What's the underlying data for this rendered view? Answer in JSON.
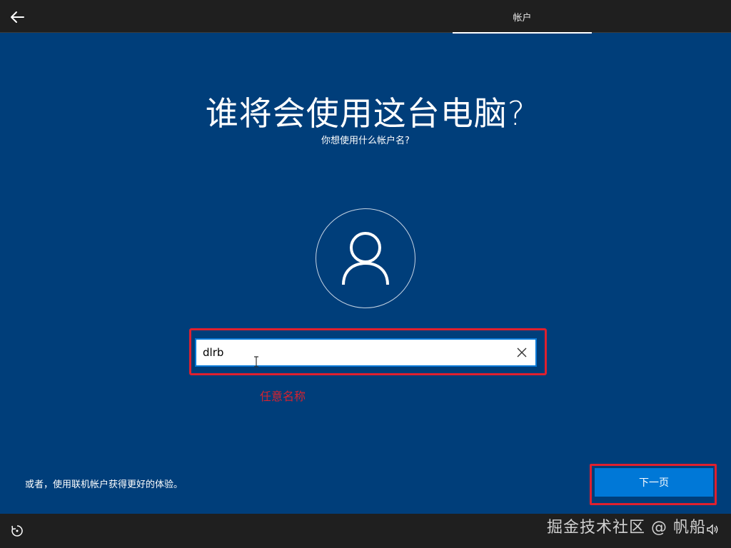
{
  "header": {
    "tab_label": "帐户"
  },
  "main": {
    "title": "谁将会使用这台电脑?",
    "subtitle": "你想使用什么帐户名?",
    "username_value": "dlrb",
    "annotation": "任意名称",
    "online_link": "或者，使用联机帐户获得更好的体验。",
    "next_label": "下一页"
  },
  "footer": {
    "watermark": "掘金技术社区 @ 帆船"
  },
  "icons": {
    "back": "back-arrow-icon",
    "avatar": "user-icon",
    "clear": "close-icon",
    "ease_of_access": "ease-of-access-icon",
    "volume": "volume-icon"
  },
  "colors": {
    "background": "#003e7a",
    "bar": "#1f1f1f",
    "accent": "#0078d7",
    "highlight": "#e0202e"
  }
}
